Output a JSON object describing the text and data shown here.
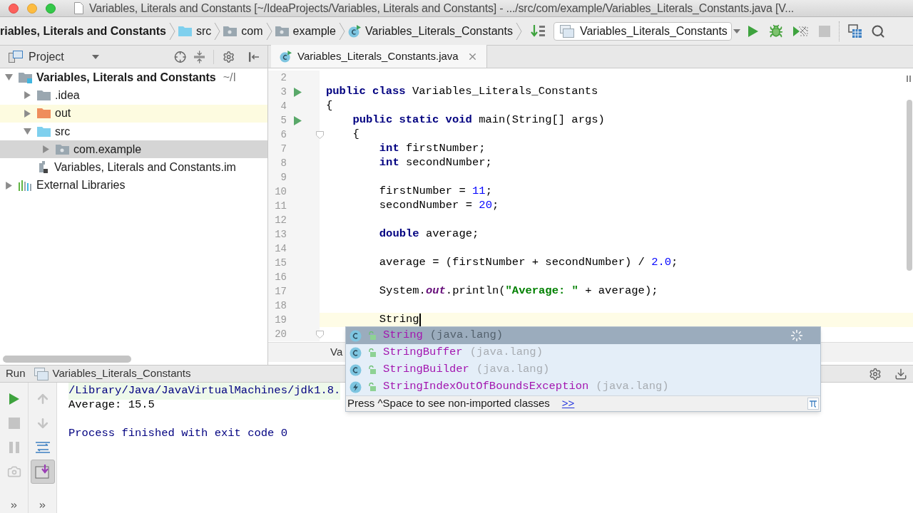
{
  "window": {
    "title": "Variables, Literals and Constants [~/IdeaProjects/Variables, Literals and Constants] - .../src/com/example/Variables_Literals_Constants.java [V..."
  },
  "navigation_bar": {
    "breadcrumbs": [
      {
        "label": "riables, Literals and Constants",
        "kind": "module"
      },
      {
        "label": "src",
        "kind": "source"
      },
      {
        "label": "com",
        "kind": "package"
      },
      {
        "label": "example",
        "kind": "package"
      },
      {
        "label": "Variables_Literals_Constants",
        "kind": "class"
      }
    ],
    "run_configuration": "Variables_Literals_Constants",
    "toolbar": [
      {
        "kind": "run",
        "disabled": false
      },
      {
        "kind": "debug",
        "disabled": false
      },
      {
        "kind": "coverage",
        "disabled": false
      },
      {
        "kind": "stop",
        "disabled": true
      }
    ]
  },
  "project_panel": {
    "title": "Project",
    "tree": [
      {
        "label": "Variables, Literals and Constants",
        "hint": "~/I",
        "kind": "module",
        "expanded": true,
        "selected": false,
        "children": [
          {
            "label": ".idea",
            "kind": "folder",
            "expanded": false,
            "selected": false
          },
          {
            "label": "out",
            "kind": "excluded",
            "expanded": false,
            "selected": false
          },
          {
            "label": "src",
            "kind": "source",
            "expanded": true,
            "selected": false,
            "children": [
              {
                "label": "com.example",
                "kind": "package",
                "expanded": false,
                "selected": true
              }
            ]
          },
          {
            "label": "Variables, Literals and Constants.im",
            "kind": "file",
            "selected": false
          }
        ]
      },
      {
        "label": "External Libraries",
        "kind": "library",
        "expanded": false,
        "selected": false
      }
    ]
  },
  "editor": {
    "tabs": [
      {
        "label": "Variables_Literals_Constants.java",
        "selected": true
      }
    ],
    "lines": [
      {
        "number": "2"
      },
      {
        "number": "3",
        "kind": "run",
        "tokens": [
          {
            "text": "public class",
            "kind": "keyword"
          },
          {
            "text": " Variables_Literals_Constants",
            "kind": "plain"
          }
        ]
      },
      {
        "number": "4",
        "tokens": [
          {
            "text": "{",
            "kind": "plain"
          }
        ],
        "children": [
          {
            "number": "5",
            "kind": "run",
            "tokens": [
              {
                "text": "public static void",
                "kind": "keyword"
              },
              {
                "text": " main(String[] args)",
                "kind": "plain"
              }
            ]
          },
          {
            "number": "6",
            "kind": "fold",
            "tokens": [
              {
                "text": "{",
                "kind": "plain"
              }
            ],
            "children": [
              {
                "number": "7",
                "tokens": [
                  {
                    "text": "int",
                    "kind": "keyword"
                  },
                  {
                    "text": " firstNumber;",
                    "kind": "plain"
                  }
                ]
              },
              {
                "number": "8",
                "tokens": [
                  {
                    "text": "int",
                    "kind": "keyword"
                  },
                  {
                    "text": " secondNumber;",
                    "kind": "plain"
                  }
                ]
              },
              {
                "number": "9"
              },
              {
                "number": "10",
                "tokens": [
                  {
                    "text": "firstNumber = ",
                    "kind": "plain"
                  },
                  {
                    "text": "11",
                    "kind": "number"
                  },
                  {
                    "text": ";",
                    "kind": "plain"
                  }
                ]
              },
              {
                "number": "11",
                "tokens": [
                  {
                    "text": "secondNumber = ",
                    "kind": "plain"
                  },
                  {
                    "text": "20",
                    "kind": "number"
                  },
                  {
                    "text": ";",
                    "kind": "plain"
                  }
                ]
              },
              {
                "number": "12"
              },
              {
                "number": "13",
                "tokens": [
                  {
                    "text": "double",
                    "kind": "keyword"
                  },
                  {
                    "text": " average;",
                    "kind": "plain"
                  }
                ]
              },
              {
                "number": "14"
              },
              {
                "number": "15",
                "tokens": [
                  {
                    "text": "average = (firstNumber + secondNumber) / ",
                    "kind": "plain"
                  },
                  {
                    "text": "2.0",
                    "kind": "number"
                  },
                  {
                    "text": ";",
                    "kind": "plain"
                  }
                ]
              },
              {
                "number": "16"
              },
              {
                "number": "17",
                "tokens": [
                  {
                    "text": "System.",
                    "kind": "plain"
                  },
                  {
                    "text": "out",
                    "kind": "field"
                  },
                  {
                    "text": ".println(",
                    "kind": "plain"
                  },
                  {
                    "text": "\"Average: \"",
                    "kind": "string"
                  },
                  {
                    "text": " + average);",
                    "kind": "plain"
                  }
                ]
              },
              {
                "number": "18"
              },
              {
                "number": "19",
                "current": true,
                "tokens": [
                  {
                    "text": "String",
                    "kind": "plain"
                  }
                ]
              }
            ]
          },
          {
            "number": "20",
            "kind": "fold"
          }
        ]
      }
    ],
    "footer": "Va"
  },
  "run_panel": {
    "title": "Run",
    "configuration": "Variables_Literals_Constants",
    "left_toolbar": [
      {
        "kind": "rerun",
        "disabled": false
      },
      {
        "kind": "stop",
        "disabled": true
      },
      {
        "kind": "pause",
        "disabled": true
      },
      {
        "kind": "camera",
        "disabled": true
      }
    ],
    "right_toolbar": [
      {
        "kind": "up",
        "disabled": true
      },
      {
        "kind": "down",
        "disabled": true
      },
      {
        "kind": "wrap",
        "on": false
      },
      {
        "kind": "scroll-end",
        "on": true
      }
    ],
    "output": [
      {
        "kind": "command",
        "text": "/Library/Java/JavaVirtualMachines/jdk1.8."
      },
      {
        "kind": "stdout",
        "text": "Average: 15.5"
      },
      {
        "kind": "blank"
      },
      {
        "kind": "system",
        "text": "Process finished with exit code 0"
      }
    ]
  },
  "completion_popup": {
    "items": [
      {
        "name": "String",
        "package": "(java.lang)",
        "kind": "class",
        "selected": true
      },
      {
        "name": "StringBuffer",
        "package": "(java.lang)",
        "kind": "class",
        "selected": false
      },
      {
        "name": "StringBuilder",
        "package": "(java.lang)",
        "kind": "class",
        "selected": false
      },
      {
        "name": "StringIndexOutOfBoundsException",
        "package": "(java.lang)",
        "kind": "exception",
        "selected": false
      }
    ],
    "hint": "Press ^Space to see non-imported classes",
    "link": ">>"
  }
}
